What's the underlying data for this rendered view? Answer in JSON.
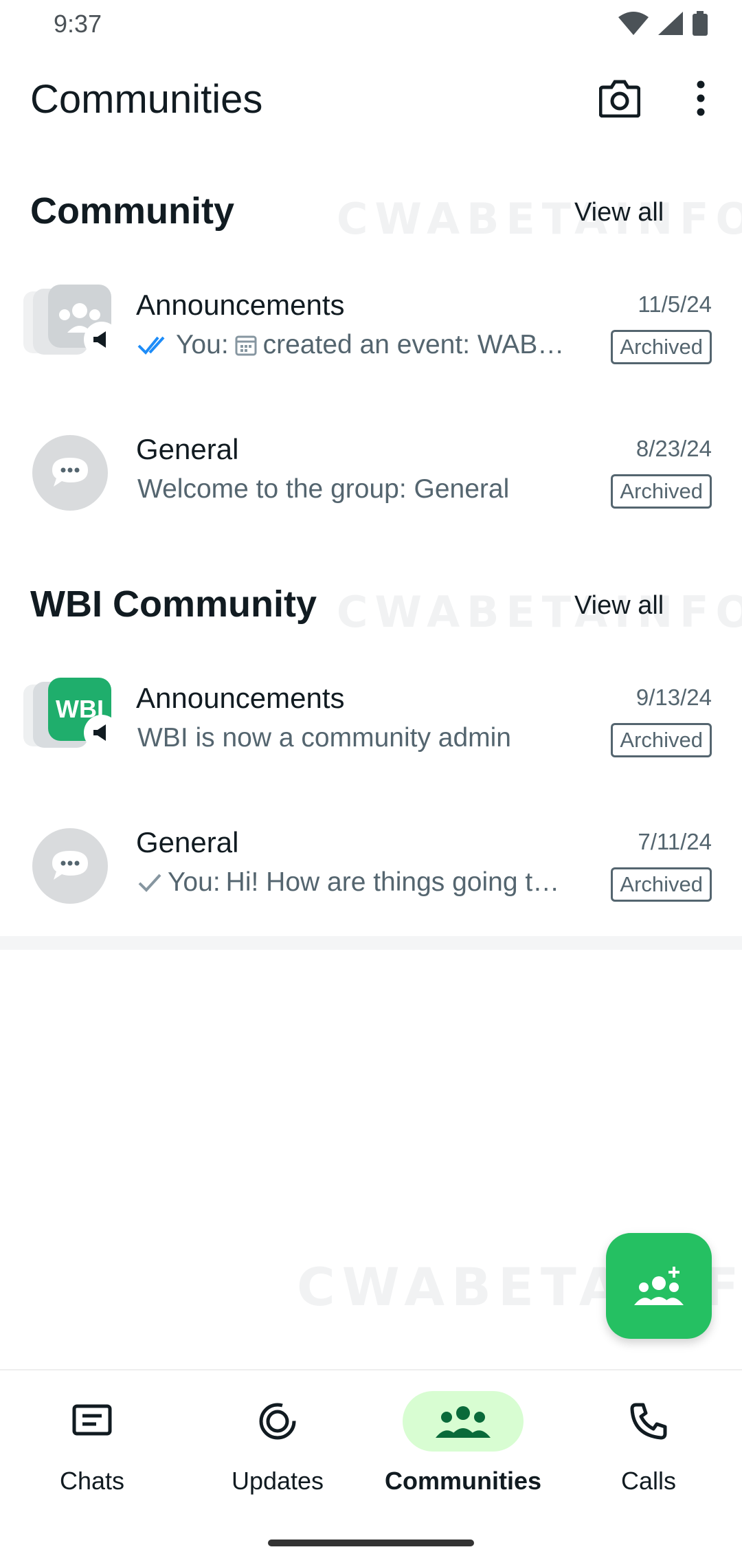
{
  "status": {
    "time": "9:37"
  },
  "app": {
    "title": "Communities"
  },
  "watermark": "CWABETAINFO",
  "sections": [
    {
      "title": "Community",
      "view_all": "View all",
      "rows": [
        {
          "name": "Announcements",
          "prefix": "You:",
          "message": "created an event: WAB…",
          "date": "11/5/24",
          "badge": "Archived"
        },
        {
          "name": "General",
          "message": "Welcome to the group: General",
          "date": "8/23/24",
          "badge": "Archived"
        }
      ]
    },
    {
      "title": "WBI Community",
      "view_all": "View all",
      "rows": [
        {
          "name": "Announcements",
          "avatar_text": "WBI",
          "message": "WBI is now a community admin",
          "date": "9/13/24",
          "badge": "Archived"
        },
        {
          "name": "General",
          "prefix": "You:",
          "message": "Hi! How are things going t…",
          "date": "7/11/24",
          "badge": "Archived"
        }
      ]
    }
  ],
  "nav": {
    "chats": "Chats",
    "updates": "Updates",
    "communities": "Communities",
    "calls": "Calls"
  },
  "colors": {
    "accent": "#25c062",
    "active_nav_bg": "#d8fdd2",
    "read_tick": "#1d8cf8"
  }
}
